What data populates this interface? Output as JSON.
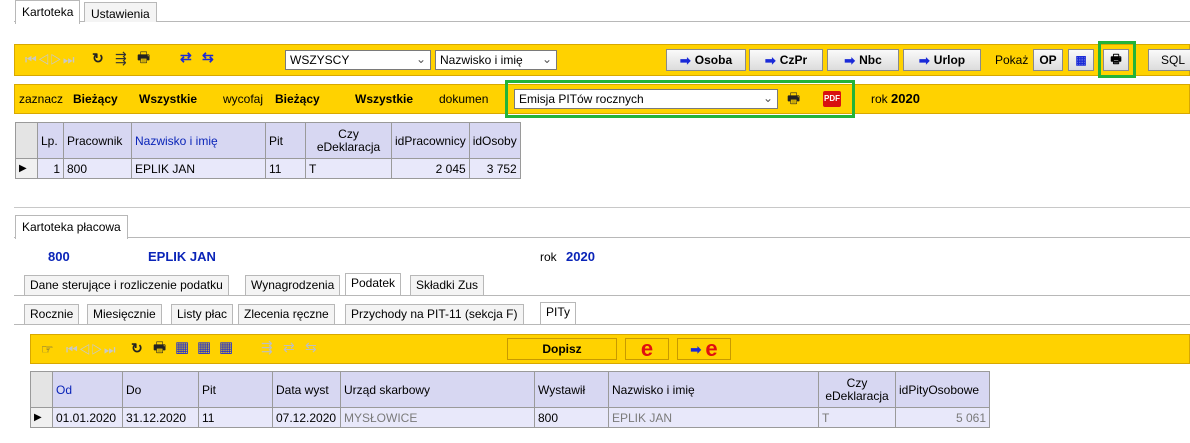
{
  "top_tabs": [
    "Kartoteka",
    "Ustawienia"
  ],
  "toolbar1": {
    "filter_select": "WSZYSCY",
    "sort_select": "Nazwisko i imię",
    "buttons": [
      "Osoba",
      "CzPr",
      "Nbc",
      "Urlop"
    ],
    "show_label": "Pokaż",
    "op_button": "OP",
    "sql_button": "SQL"
  },
  "toolbar2": {
    "mark_label": "zaznacz",
    "mark_current": "Bieżący",
    "mark_all": "Wszystkie",
    "unmark_label": "wycofaj",
    "unmark_current": "Bieżący",
    "unmark_all": "Wszystkie",
    "document_label": "dokumen",
    "document_select": "Emisja PITów rocznych",
    "pdf_icon_text": "PDF",
    "year_label": "rok",
    "year_value": "2020"
  },
  "employees_table": {
    "headers": [
      "Lp.",
      "Pracownik",
      "Nazwisko i imię",
      "Pit",
      "Czy eDeklaracja",
      "idPracownicy",
      "idOsoby"
    ],
    "rows": [
      {
        "lp": "1",
        "pracownik": "800",
        "nazwisko": "EPLIK JAN",
        "pit": "11",
        "edeklaracja": "T",
        "idPracownicy": "2 045",
        "idOsoby": "3 752"
      }
    ]
  },
  "payroll": {
    "tab_label": "Kartoteka płacowa",
    "employee_code": "800",
    "employee_name": "EPLIK JAN",
    "year_label": "rok",
    "year_value": "2020",
    "tabs": [
      "Dane sterujące i rozliczenie podatku",
      "Wynagrodzenia",
      "Podatek",
      "Składki Zus"
    ],
    "subtabs": [
      "Rocznie",
      "Miesięcznie",
      "Listy płac",
      "Zlecenia ręczne",
      "Przychody na PIT-11 (sekcja F)",
      "PITy"
    ],
    "add_button": "Dopisz",
    "e_label": "e",
    "pity_table": {
      "headers": [
        "Od",
        "Do",
        "Pit",
        "Data wyst",
        "Urząd skarbowy",
        "Wystawił",
        "Nazwisko i imię",
        "Czy eDeklaracja",
        "idPityOsobowe"
      ],
      "rows": [
        {
          "od": "01.01.2020",
          "do": "31.12.2020",
          "pit": "11",
          "data_wyst": "07.12.2020",
          "urzad": "MYSŁOWICE",
          "wystawil": "800",
          "nazwisko": "EPLIK JAN",
          "edeklaracja": "T",
          "id": "5 061"
        }
      ]
    }
  },
  "colors": {
    "toolbar": "#ffd200",
    "highlight": "#22b33a",
    "header_bg": "#d7d7f2",
    "link_blue": "#0a24b8"
  }
}
